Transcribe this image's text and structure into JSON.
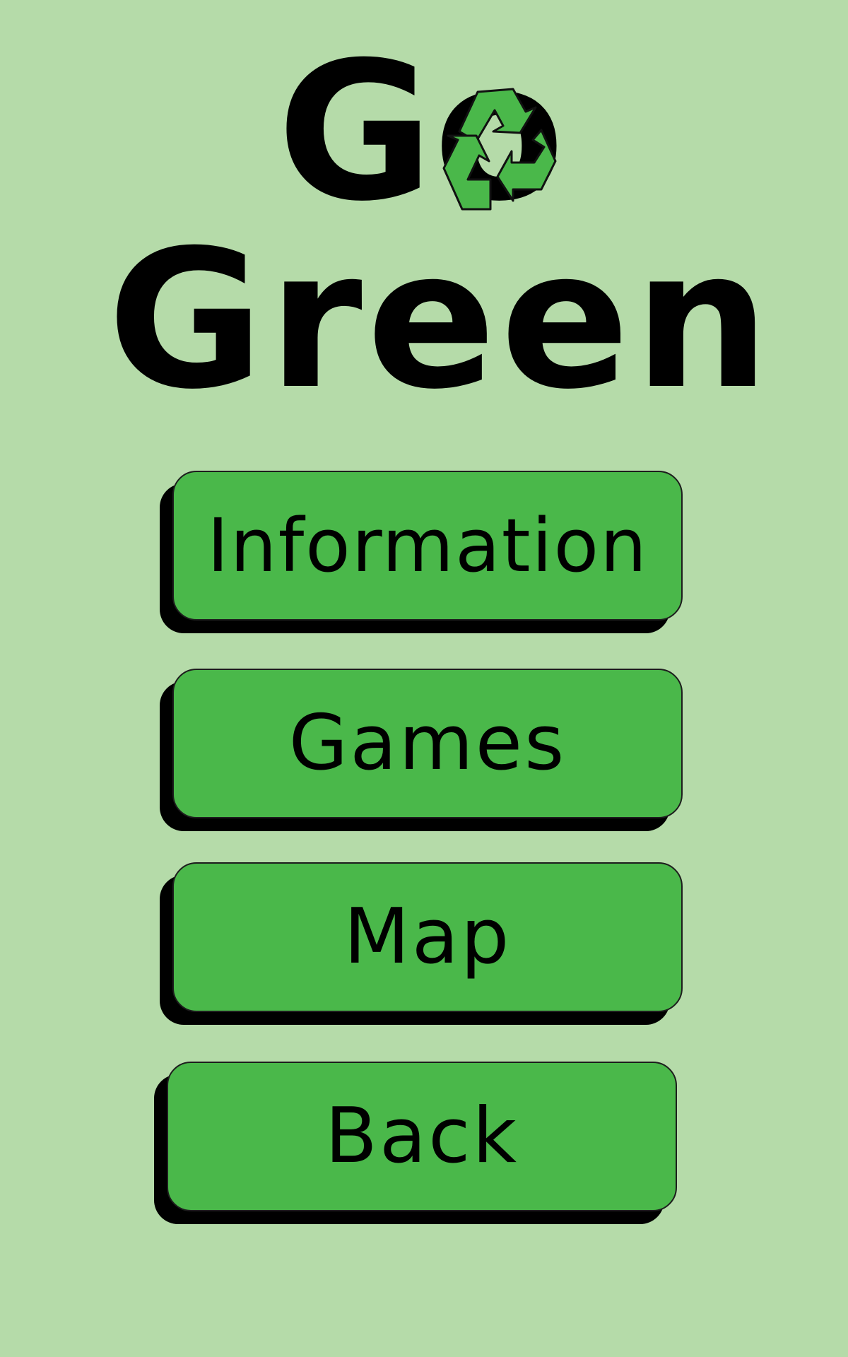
{
  "app": {
    "title_line_1": "Go",
    "title_line_2": "Green",
    "logo_icon": "recycle-icon",
    "background_color": "#b5dba9",
    "button_color": "#4ab84a",
    "shadow_color": "#000000"
  },
  "menu": {
    "information_label": "Information",
    "games_label": "Games",
    "map_label": "Map",
    "back_label": "Back"
  }
}
